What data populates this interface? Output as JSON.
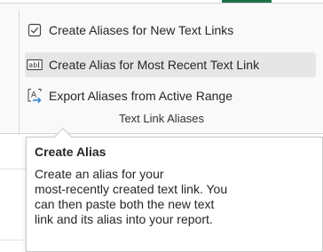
{
  "ribbon": {
    "items": [
      {
        "icon": "checkbox-icon",
        "label": "Create Aliases for New Text Links"
      },
      {
        "icon": "text-field-icon",
        "label": "Create Alias for Most Recent Text Link"
      },
      {
        "icon": "export-icon",
        "label": "Export Aliases from Active Range"
      }
    ],
    "group_label": "Text Link Aliases"
  },
  "tooltip": {
    "title": "Create Alias",
    "lines": [
      "Create an alias for your",
      "most-recently created text link. You",
      "can then paste both the new text",
      "link and its alias into your report."
    ]
  },
  "colors": {
    "accent_tab": "#1e7145",
    "hover_bg": "#e6e6e6",
    "export_icon_blue": "#2f7fd0"
  }
}
